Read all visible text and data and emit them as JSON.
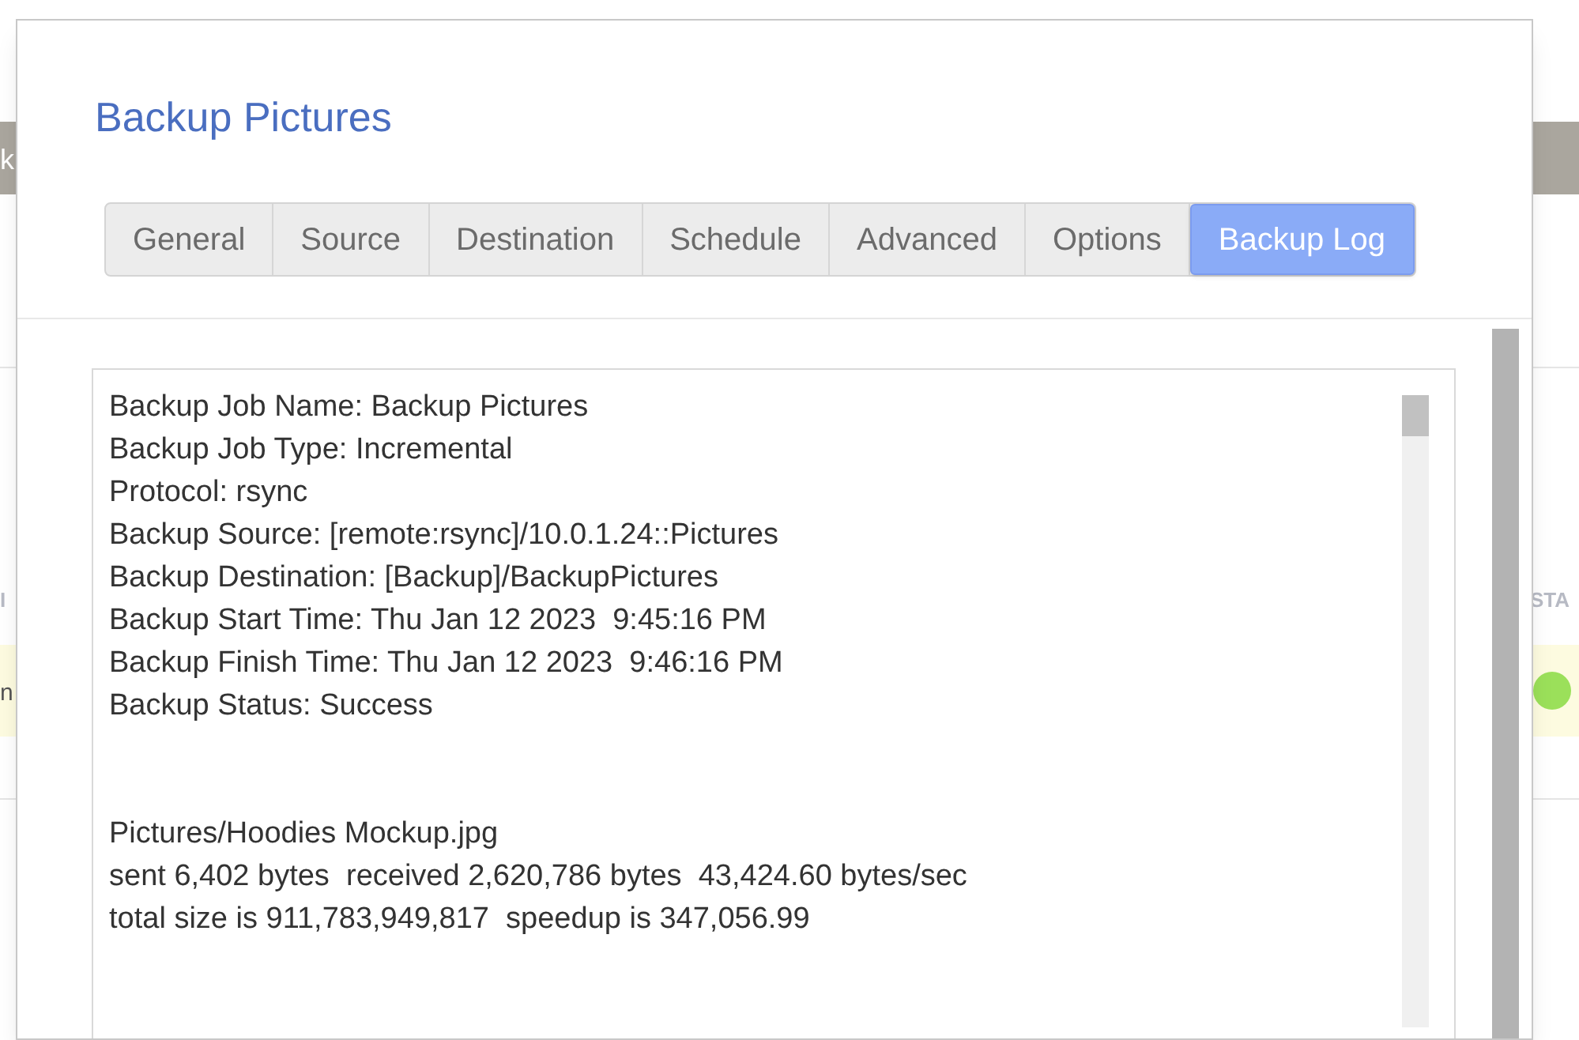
{
  "background": {
    "left_button": "k",
    "left_header": "I",
    "left_cell": "n",
    "right_header": "STA"
  },
  "dialog": {
    "title": "Backup Pictures",
    "tabs": [
      {
        "label": "General",
        "selected": false
      },
      {
        "label": "Source",
        "selected": false
      },
      {
        "label": "Destination",
        "selected": false
      },
      {
        "label": "Schedule",
        "selected": false
      },
      {
        "label": "Advanced",
        "selected": false
      },
      {
        "label": "Options",
        "selected": false
      },
      {
        "label": "Backup Log",
        "selected": true
      }
    ],
    "log": {
      "sections": [
        [
          "Backup Job Name: Backup Pictures",
          "Backup Job Type: Incremental",
          "Protocol: rsync",
          "Backup Source: [remote:rsync]/10.0.1.24::Pictures",
          "Backup Destination: [Backup]/BackupPictures",
          "Backup Start Time: Thu Jan 12 2023  9:45:16 PM",
          "Backup Finish Time: Thu Jan 12 2023  9:46:16 PM",
          "Backup Status: Success"
        ],
        [
          "Pictures/Hoodies Mockup.jpg",
          "sent 6,402 bytes  received 2,620,786 bytes  43,424.60 bytes/sec",
          "total size is 911,783,949,817  speedup is 347,056.99"
        ]
      ]
    }
  }
}
